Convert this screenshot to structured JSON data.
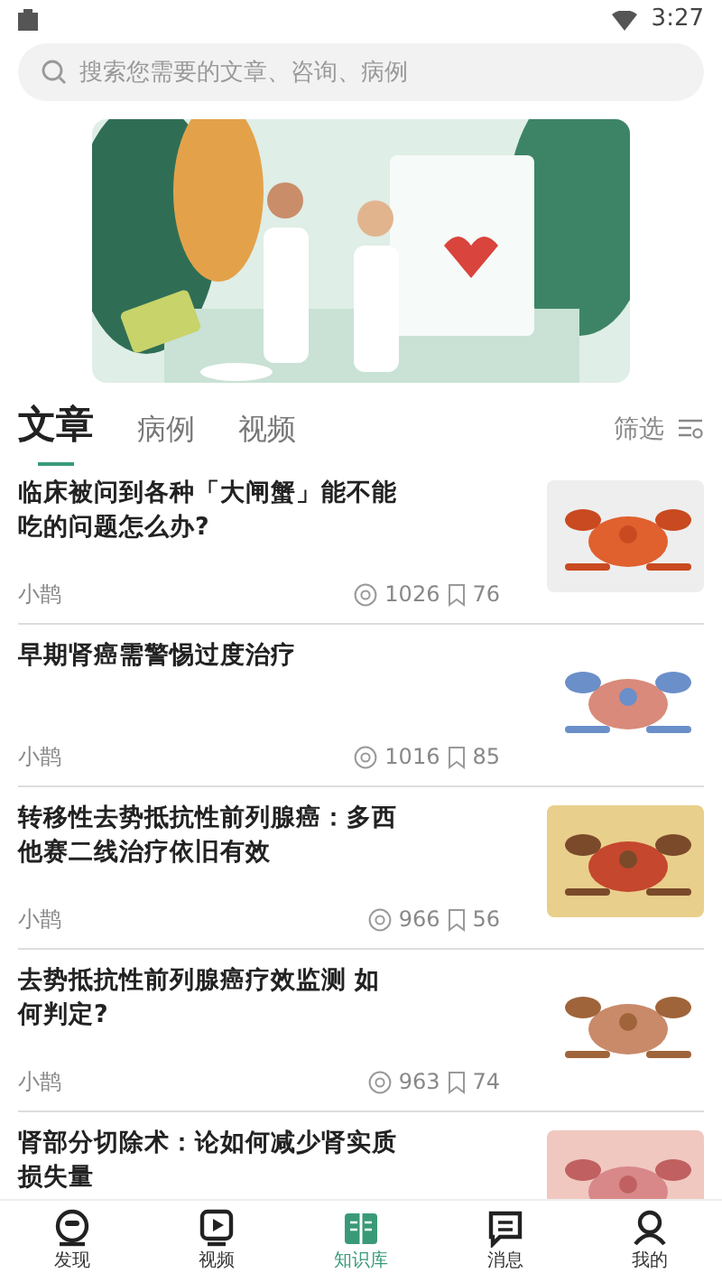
{
  "status_bar": {
    "time": "3:27"
  },
  "search": {
    "placeholder": "搜索您需要的文章、咨询、病例"
  },
  "tabs": [
    {
      "label": "文章",
      "selected": true
    },
    {
      "label": "病例",
      "selected": false
    },
    {
      "label": "视频",
      "selected": false
    }
  ],
  "filter": {
    "label": "筛选"
  },
  "articles": [
    {
      "title": "临床被问到各种「大闸蟹」能不能吃的问题怎么办?",
      "author": "小鹊",
      "views": "1026",
      "favorites": "76"
    },
    {
      "title": "早期肾癌需警惕过度治疗",
      "author": "小鹊",
      "views": "1016",
      "favorites": "85"
    },
    {
      "title": "转移性去势抵抗性前列腺癌：多西他赛二线治疗依旧有效",
      "author": "小鹊",
      "views": "966",
      "favorites": "56"
    },
    {
      "title": "去势抵抗性前列腺癌疗效监测 如何判定?",
      "author": "小鹊",
      "views": "963",
      "favorites": "74"
    },
    {
      "title": "肾部分切除术：论如何减少肾实质损失量"
    }
  ],
  "bottom_nav": [
    {
      "label": "发现",
      "selected": false
    },
    {
      "label": "视频",
      "selected": false
    },
    {
      "label": "知识库",
      "selected": true
    },
    {
      "label": "消息",
      "selected": false
    },
    {
      "label": "我的",
      "selected": false
    }
  ]
}
